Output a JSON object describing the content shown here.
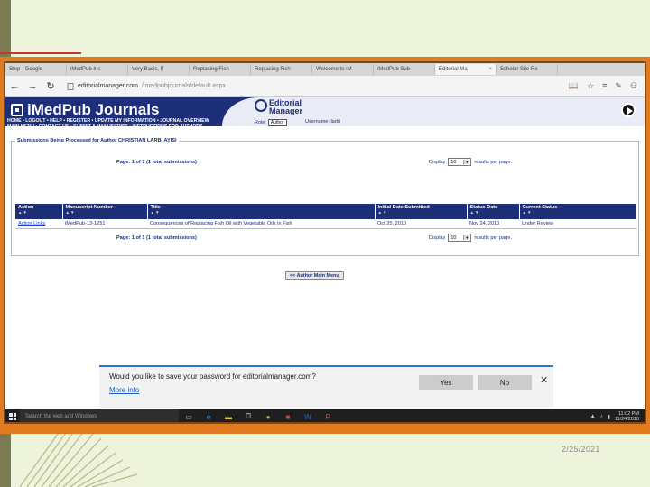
{
  "browser": {
    "tabs": [
      {
        "label": "Step - Google"
      },
      {
        "label": "iMedPub Inc"
      },
      {
        "label": "Very Basic, If"
      },
      {
        "label": "Replacing Fish"
      },
      {
        "label": "Replacing Fish"
      },
      {
        "label": "Welcome to iM"
      },
      {
        "label": "iMedPub Sub"
      },
      {
        "label": "Editorial Ma",
        "active": true
      },
      {
        "label": "Scholar Site Re"
      }
    ],
    "tab_close": "×",
    "back_icon": "←",
    "forward_icon": "→",
    "refresh_icon": "↻",
    "url_host": "editorialmanager.com",
    "url_path": "/imedpubjournals/default.aspx"
  },
  "journal": {
    "name": "iMedPub Journals",
    "menu_line1": "HOME • LOGOUT • HELP • REGISTER • UPDATE MY INFORMATION • JOURNAL OVERVIEW",
    "menu_line2": "MAIN MENU • CONTACT US • SUBMIT A MANUSCRIPT • INSTRUCTIONS FOR AUTHORS",
    "brand_line1": "Editorial",
    "brand_line2": "Manager",
    "role_label": "Role:",
    "role_value": "Author",
    "username_label": "Username:",
    "username_value": "larbi"
  },
  "submissions": {
    "section_title": "Submissions Being Processed for Author CHRISTIAN LARBI AYISI",
    "page_info": "Page: 1 of 1 (1 total submissions)",
    "display_label": "Display",
    "display_value": "10",
    "display_suffix": "results per page.",
    "columns": [
      "Action",
      "Manuscript Number",
      "Title",
      "Initial Date Submitted",
      "Status Date",
      "Current Status"
    ],
    "sort_arrows": "▲▼",
    "rows": [
      {
        "action": "Action Links",
        "manuscript": "iMedPub-13-1251",
        "title": "Consequences of Replacing Fish Oil with Vegetable Oils in Fish",
        "initial_date": "Oct 25, 2010",
        "status_date": "Nov 24, 2010",
        "status": "Under Review"
      }
    ],
    "main_menu_button": "<< Author Main Menu"
  },
  "password_prompt": {
    "message": "Would you like to save your password for editorialmanager.com?",
    "more_info": "More info",
    "yes": "Yes",
    "no": "No",
    "close": "✕"
  },
  "taskbar": {
    "search_placeholder": "Search the web and Windows",
    "time": "11:02 PM",
    "date": "11/24/2010"
  },
  "slide": {
    "date": "2/25/2021"
  }
}
